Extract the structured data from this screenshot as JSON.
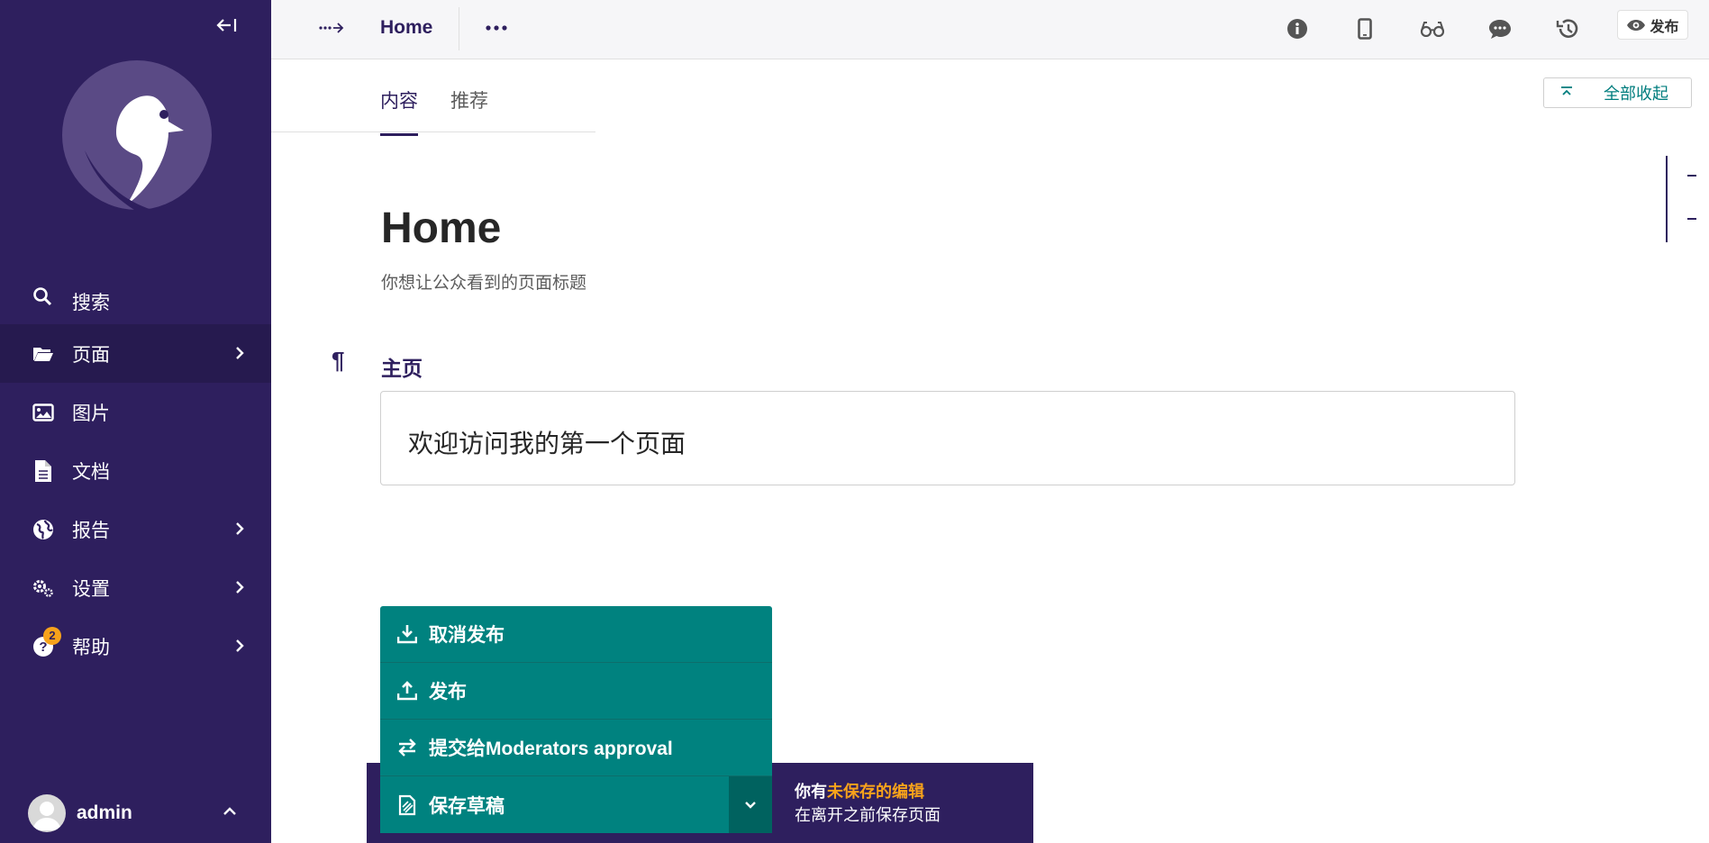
{
  "sidebar": {
    "search_label": "搜索",
    "items": [
      {
        "label": "页面",
        "has_submenu": true,
        "active": true
      },
      {
        "label": "图片",
        "has_submenu": false
      },
      {
        "label": "文档",
        "has_submenu": false
      },
      {
        "label": "报告",
        "has_submenu": true
      },
      {
        "label": "设置",
        "has_submenu": true
      },
      {
        "label": "帮助",
        "has_submenu": true,
        "badge": "2"
      }
    ],
    "user": {
      "name": "admin"
    }
  },
  "header": {
    "breadcrumb_title": "Home",
    "preview_label": "发布"
  },
  "tabs": [
    {
      "label": "内容",
      "active": true
    },
    {
      "label": "推荐",
      "active": false
    }
  ],
  "collapse_all_label": "全部收起",
  "page": {
    "title": "Home",
    "title_help": "你想让公众看到的页面标题",
    "field_label": "主页",
    "field_value": "欢迎访问我的第一个页面"
  },
  "actions": {
    "unpublish": "取消发布",
    "publish": "发布",
    "submit": "提交给Moderators approval",
    "save_draft": "保存草稿"
  },
  "unsaved": {
    "prefix": "你有",
    "highlight": "未保存的编辑",
    "line2": "在离开之前保存页面"
  },
  "colors": {
    "sidebar": "#2e1f5e",
    "accent": "#00827f",
    "warning": "#f7a21b"
  }
}
